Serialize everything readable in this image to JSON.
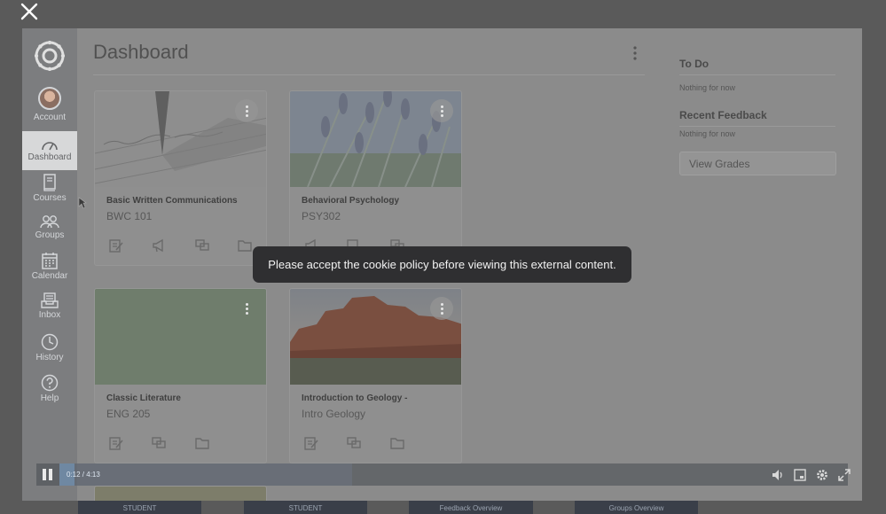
{
  "sidebar": {
    "items": [
      {
        "label": "Account",
        "icon": "avatar"
      },
      {
        "label": "Dashboard",
        "icon": "dashboard-icon",
        "active": true
      },
      {
        "label": "Courses",
        "icon": "courses-icon"
      },
      {
        "label": "Groups",
        "icon": "groups-icon"
      },
      {
        "label": "Calendar",
        "icon": "calendar-icon"
      },
      {
        "label": "Inbox",
        "icon": "inbox-icon"
      },
      {
        "label": "History",
        "icon": "history-icon"
      },
      {
        "label": "Help",
        "icon": "help-icon"
      }
    ]
  },
  "header": {
    "title": "Dashboard"
  },
  "cards": [
    {
      "title": "Basic Written Communications",
      "code": "BWC 101",
      "image": "pen-writing",
      "color": "#8a8a8a"
    },
    {
      "title": "Behavioral Psychology",
      "code": "PSY302",
      "image": "lavender",
      "color": "#6f7b86"
    },
    {
      "title": "Classic Literature",
      "code": "ENG 205",
      "image": "solid",
      "color": "#6f7d6c"
    },
    {
      "title": "Introduction to Geology -",
      "code": "Intro Geology",
      "image": "red-rocks",
      "color": "#7a5a4a"
    }
  ],
  "aside": {
    "todo_title": "To Do",
    "todo_empty": "Nothing for now",
    "feedback_title": "Recent Feedback",
    "feedback_empty": "Nothing for now",
    "grades_button": "View Grades"
  },
  "player": {
    "time": "0:12 / 4:13",
    "progress": 0.05
  },
  "toast": {
    "message": "Please accept the cookie policy before viewing this external content."
  },
  "under_strip": [
    "STUDENT",
    "STUDENT",
    "Feedback Overview",
    "Groups Overview"
  ]
}
